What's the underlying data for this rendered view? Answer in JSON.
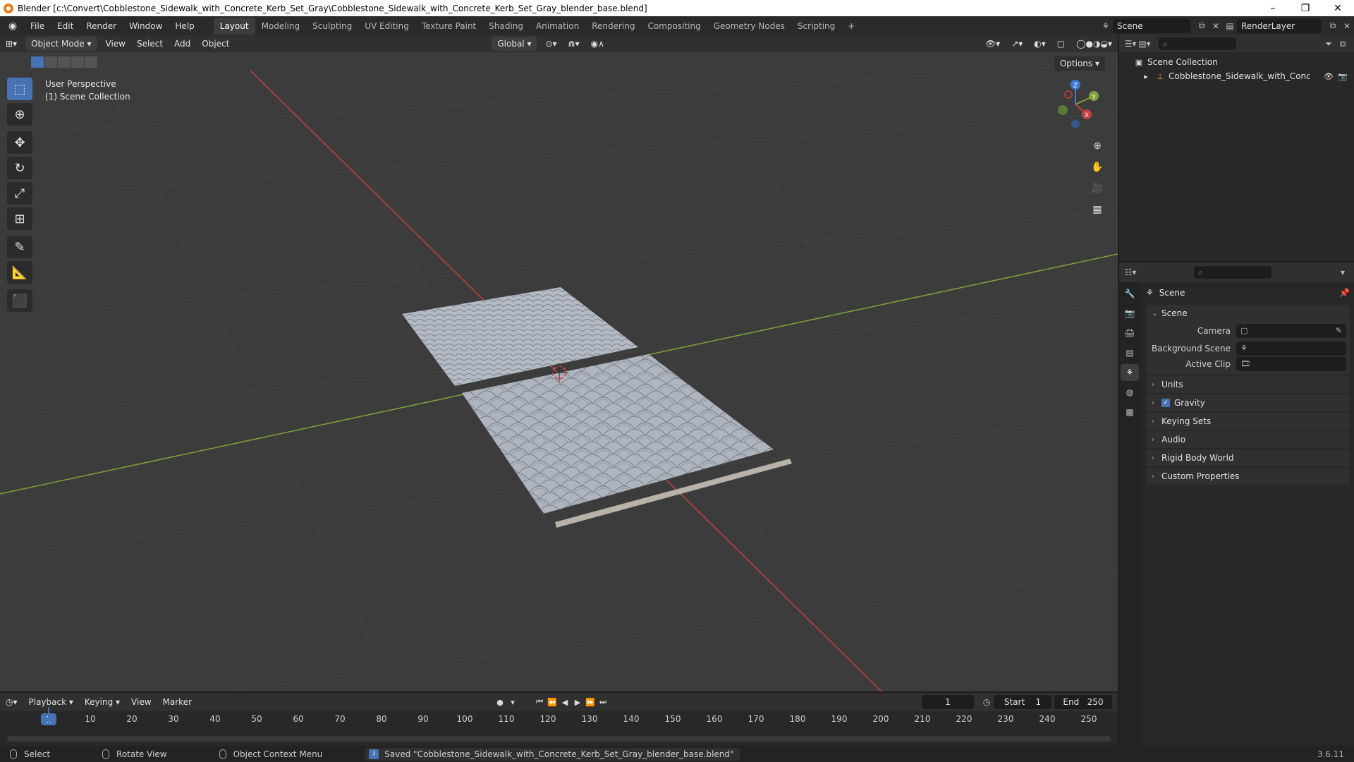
{
  "window": {
    "title": "Blender [c:\\Convert\\Cobblestone_Sidewalk_with_Concrete_Kerb_Set_Gray\\Cobblestone_Sidewalk_with_Concrete_Kerb_Set_Gray_blender_base.blend]",
    "minimize": "–",
    "maximize": "❐",
    "close": "✕"
  },
  "menu": [
    "File",
    "Edit",
    "Render",
    "Window",
    "Help"
  ],
  "workspaces": [
    "Layout",
    "Modeling",
    "Sculpting",
    "UV Editing",
    "Texture Paint",
    "Shading",
    "Animation",
    "Rendering",
    "Compositing",
    "Geometry Nodes",
    "Scripting",
    "+"
  ],
  "scene_name": "Scene",
  "render_layer": "RenderLayer",
  "viewport": {
    "mode": "Object Mode",
    "menus": [
      "View",
      "Select",
      "Add",
      "Object"
    ],
    "transform_orientation": "Global",
    "options_label": "Options",
    "perspective_label": "User Perspective",
    "collection_label": "(1) Scene Collection",
    "gizmo_axes": {
      "x": "X",
      "y": "Y",
      "z": "Z"
    }
  },
  "outliner": {
    "root": "Scene Collection",
    "child": "Cobblestone_Sidewalk_with_Concrete_K"
  },
  "properties": {
    "title": "Scene",
    "panel_scene": "Scene",
    "camera_label": "Camera",
    "background_label": "Background Scene",
    "clip_label": "Active Clip",
    "panels": [
      "Units",
      "Gravity",
      "Keying Sets",
      "Audio",
      "Rigid Body World",
      "Custom Properties"
    ]
  },
  "timeline": {
    "menus": [
      "Playback",
      "Keying",
      "View",
      "Marker"
    ],
    "current_frame": "1",
    "start_label": "Start",
    "start_value": "1",
    "end_label": "End",
    "end_value": "250",
    "ticks": [
      "10",
      "20",
      "30",
      "40",
      "50",
      "60",
      "70",
      "80",
      "90",
      "100",
      "110",
      "120",
      "130",
      "140",
      "150",
      "160",
      "170",
      "180",
      "190",
      "200",
      "210",
      "220",
      "230",
      "240",
      "250"
    ]
  },
  "status": {
    "select": "Select",
    "rotate": "Rotate View",
    "context_menu": "Object Context Menu",
    "saved": "Saved \"Cobblestone_Sidewalk_with_Concrete_Kerb_Set_Gray_blender_base.blend\"",
    "version": "3.6.11"
  },
  "colors": {
    "accent": "#4772b3",
    "x_axis": "#c2403f",
    "y_axis": "#7ea33a",
    "z_axis": "#3e7ad6"
  }
}
